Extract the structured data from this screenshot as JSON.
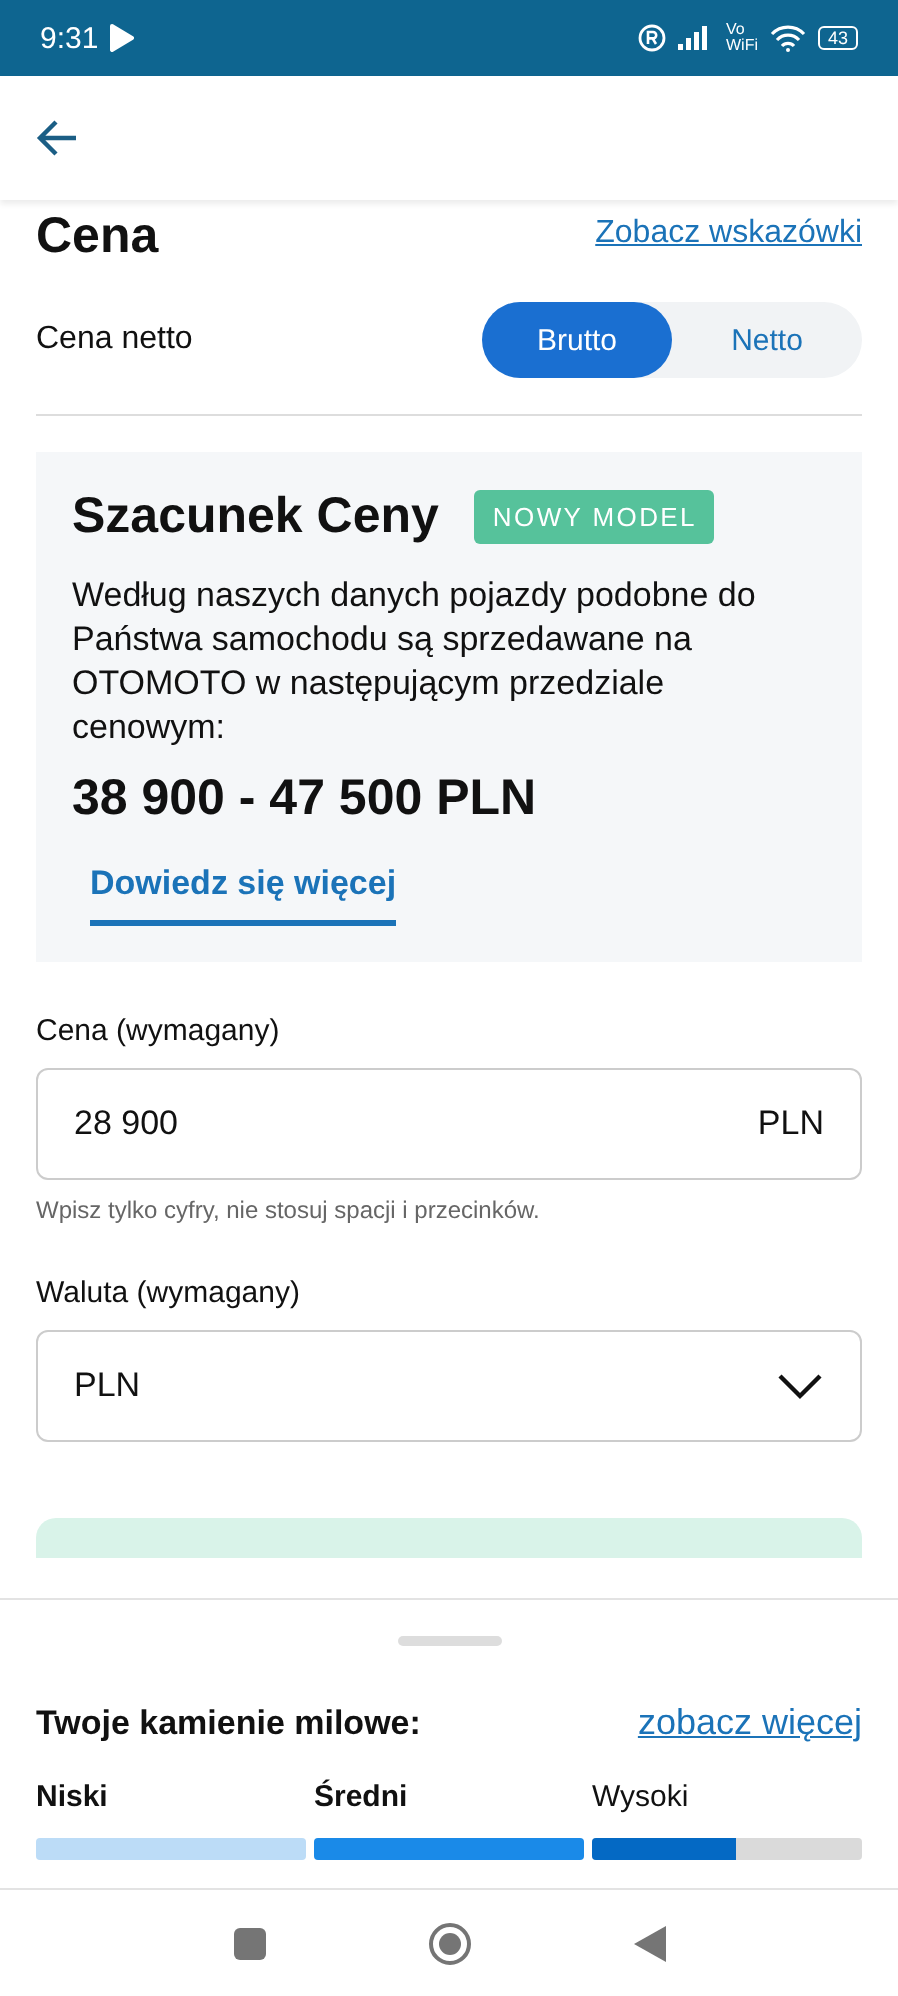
{
  "status_bar": {
    "time": "9:31",
    "network_top": "Vo",
    "network_bottom": "WiFi",
    "battery": "43"
  },
  "price_section": {
    "title": "Cena",
    "hints_link": "Zobacz wskazówki",
    "net_label": "Cena netto",
    "toggle": [
      {
        "label": "Brutto",
        "selected": true
      },
      {
        "label": "Netto",
        "selected": false
      }
    ]
  },
  "estimate": {
    "title": "Szacunek Ceny",
    "badge": "NOWY MODEL",
    "description": "Według naszych danych pojazdy podobne do Państwa samochodu są sprzedawane na OTOMOTO w następującym przedziale cenowym:",
    "range": "38 900 - 47 500 PLN",
    "more_link": "Dowiedz się więcej"
  },
  "price_field": {
    "label": "Cena (wymagany)",
    "value": "28 900",
    "suffix": "PLN",
    "helper": "Wpisz tylko cyfry, nie stosuj spacji i przecinków."
  },
  "currency_field": {
    "label": "Waluta (wymagany)",
    "value": "PLN"
  },
  "milestones": {
    "title": "Twoje kamienie milowe:",
    "link": "zobacz więcej",
    "levels": [
      {
        "label": "Niski",
        "reached": true,
        "level": 1,
        "color": "#bcdcf7"
      },
      {
        "label": "Średni",
        "reached": true,
        "level": 1,
        "color": "#1a8ae8"
      },
      {
        "label": "Wysoki",
        "reached": false,
        "level": 0.53,
        "color": "#0469c4"
      }
    ]
  }
}
